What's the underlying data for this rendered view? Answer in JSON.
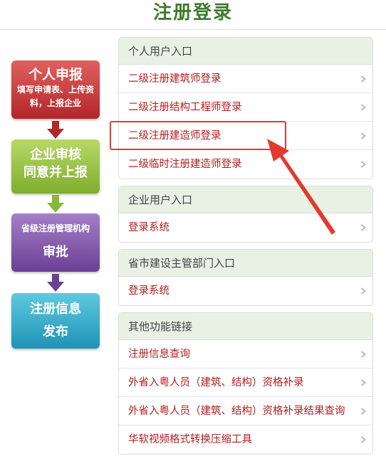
{
  "page": {
    "title": "注册登录"
  },
  "flow": [
    {
      "line1": "个人申报",
      "line2": "填写申请表、上传资料，上报企业"
    },
    {
      "line1": "企业审核",
      "line2": "同意并上报"
    },
    {
      "line1": "省级注册管理机构",
      "line2": "审批"
    },
    {
      "line1": "注册信息",
      "line2": "发布"
    }
  ],
  "panels": [
    {
      "header": "个人用户入口",
      "items": [
        "二级注册建筑师登录",
        "二级注册结构工程师登录",
        "二级注册建造师登录",
        "二级临时注册建造师登录"
      ]
    },
    {
      "header": "企业用户入口",
      "items": [
        "登录系统"
      ]
    },
    {
      "header": "省市建设主管部门入口",
      "items": [
        "登录系统"
      ]
    },
    {
      "header": "其他功能链接",
      "items": [
        "注册信息查询",
        "外省入粤人员（建筑、结构）资格补录",
        "外省入粤人员（建筑、结构）资格补录结果查询",
        "华软视频格式转换压缩工具"
      ]
    }
  ],
  "colors": {
    "title": "#3e7a2c",
    "link": "#b01e1e",
    "panel_header_bg": "#e8f1e4",
    "annotation": "#e23a30"
  },
  "icons": {
    "item_chevron": "chevron-right-icon",
    "flow_arrow": "arrow-down-icon",
    "annotation_arrow": "pointer-arrow-icon"
  },
  "annotation": {
    "highlighted_item": "二级注册建造师登录"
  }
}
